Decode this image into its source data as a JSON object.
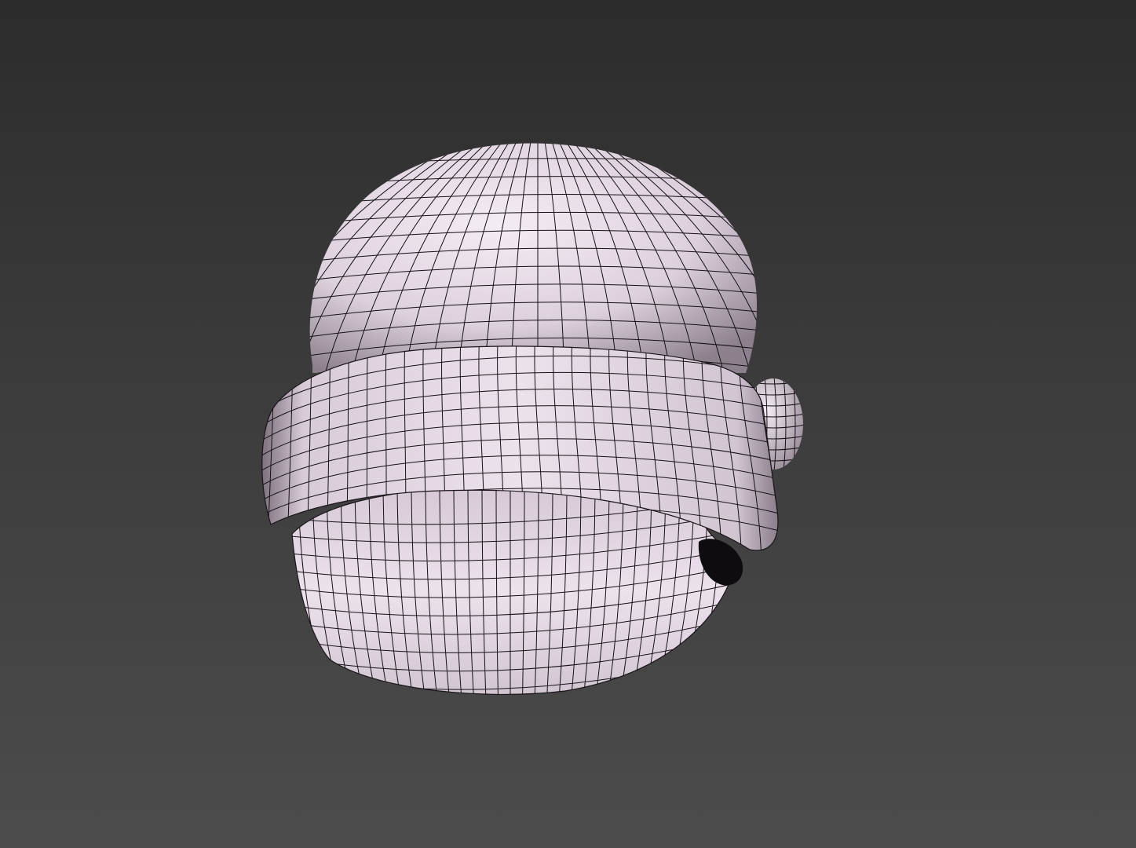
{
  "viewport": {
    "background_top": "#2c2c2c",
    "background_bottom": "#4c4c4c"
  },
  "model": {
    "name": "beanie-hat-mesh",
    "shading": "smooth-with-wireframe",
    "surface_color": "#e2d6e2",
    "surface_highlight": "#f1e9f1",
    "surface_shadow": "#8a7f8a",
    "wire_color": "#141014"
  }
}
